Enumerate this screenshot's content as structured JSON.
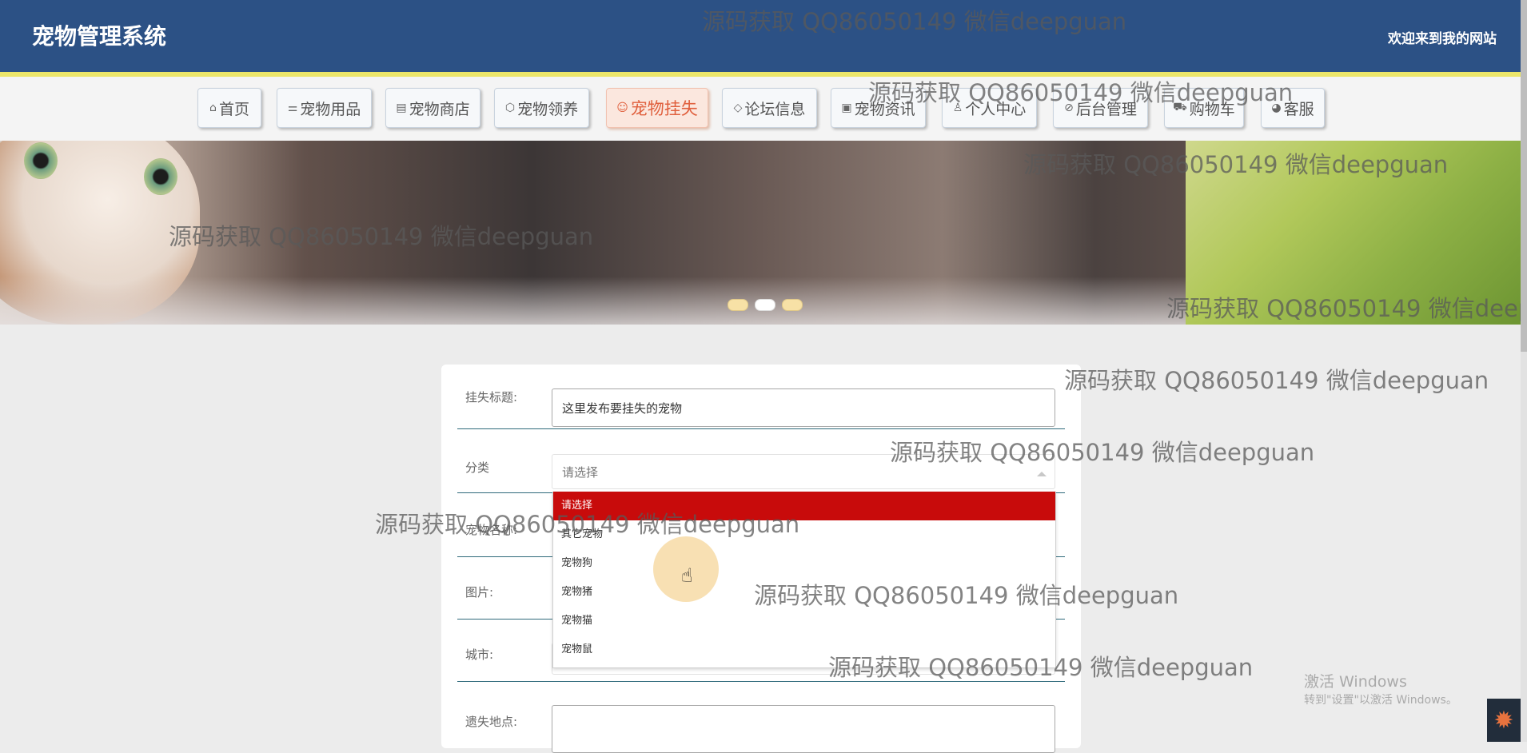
{
  "header": {
    "title": "宠物管理系统",
    "welcome": "欢迎来到我的网站"
  },
  "nav": {
    "items": [
      {
        "label": "首页",
        "icon": "home-icon",
        "glyph": "⌂"
      },
      {
        "label": "宠物用品",
        "icon": "sliders-icon",
        "glyph": "⚌"
      },
      {
        "label": "宠物商店",
        "icon": "newspaper-icon",
        "glyph": "▤"
      },
      {
        "label": "宠物领养",
        "icon": "box-icon",
        "glyph": "⬡"
      },
      {
        "label": "宠物挂失",
        "icon": "paw-icon",
        "glyph": "☺"
      },
      {
        "label": "论坛信息",
        "icon": "tag-icon",
        "glyph": "◇"
      },
      {
        "label": "宠物资讯",
        "icon": "doc-icon",
        "glyph": "▣"
      },
      {
        "label": "个人中心",
        "icon": "user-icon",
        "glyph": "♙"
      },
      {
        "label": "后台管理",
        "icon": "link-icon",
        "glyph": "⊘"
      },
      {
        "label": "购物车",
        "icon": "cart-icon",
        "glyph": "⛟"
      },
      {
        "label": "客服",
        "icon": "support-icon",
        "glyph": "◕"
      }
    ],
    "active_label": "宠物挂失"
  },
  "banner": {
    "slide_count": 3,
    "active_slide": 2
  },
  "form": {
    "title_label": "挂失标题:",
    "title_value": "这里发布要挂失的宠物",
    "category_label": "分类",
    "category_value": "请选择",
    "pet_name_label": "宠物名称:",
    "image_label": "图片:",
    "city_label": "城市:",
    "lost_place_label": "遗失地点:"
  },
  "dropdown": {
    "options": [
      "请选择",
      "其它宠物",
      "宠物狗",
      "宠物猪",
      "宠物猫",
      "宠物鼠"
    ],
    "selected": "请选择"
  },
  "watermark": {
    "text": "源码获取 QQ86050149 微信deepguan"
  },
  "windows_activation": {
    "line1": "激活 Windows",
    "line2": "转到\"设置\"以激活 Windows。"
  },
  "colors": {
    "header_bg": "#2c5185",
    "header_underline": "#ece66a",
    "active_nav": "#e0603e",
    "selected_option": "#c80b0b"
  }
}
